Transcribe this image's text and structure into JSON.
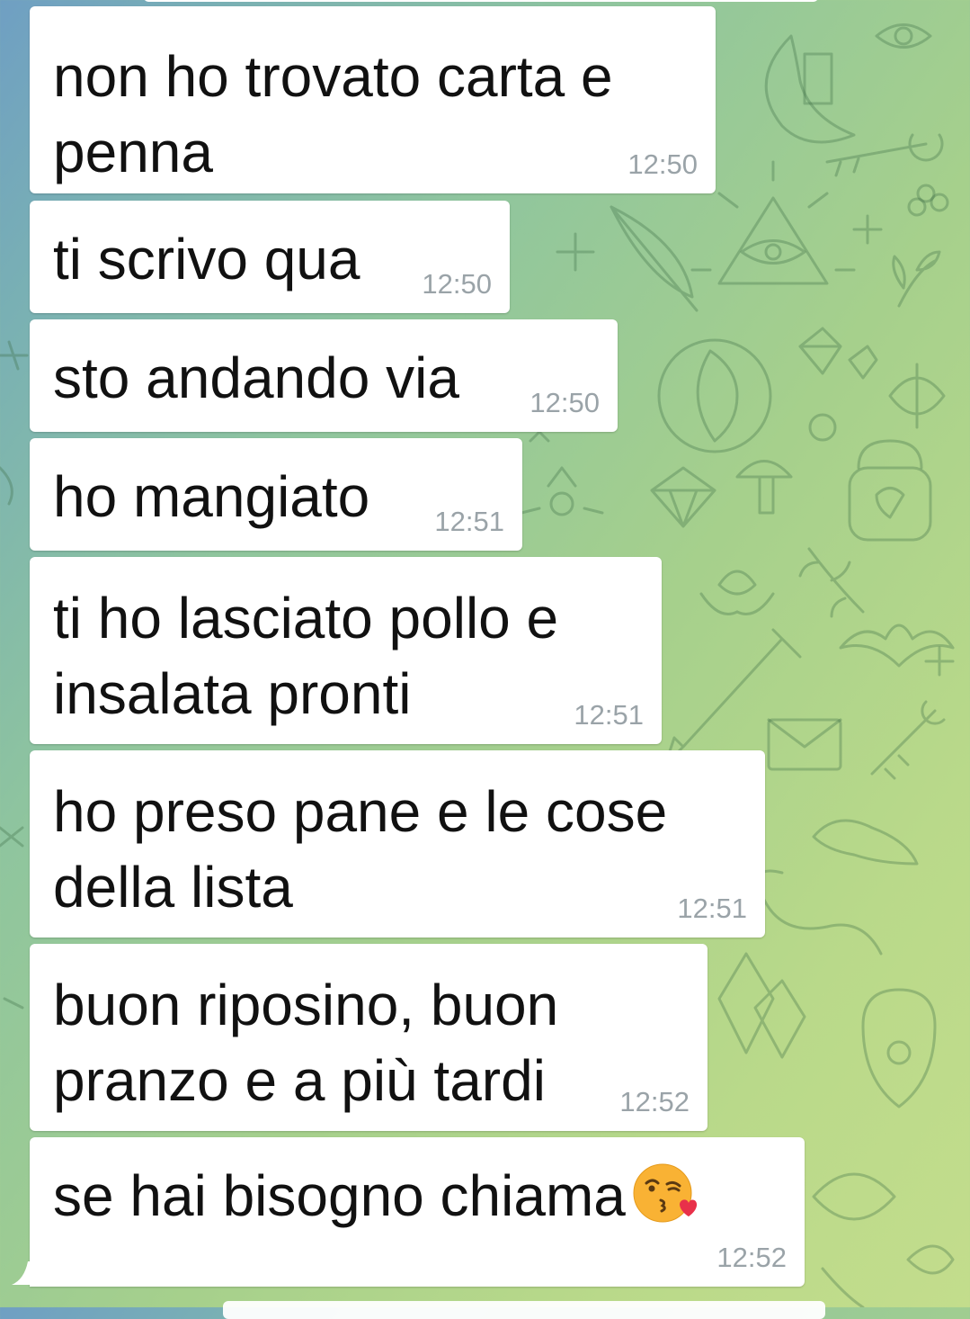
{
  "background": {
    "pattern": "telegram-doodle-wallpaper",
    "colors": [
      "#6f9fc3",
      "#8fc59e",
      "#c3dd8c"
    ]
  },
  "messages": [
    {
      "text": "non ho trovato carta e\npenna",
      "time": "12:50"
    },
    {
      "text": "ti scrivo qua",
      "time": "12:50"
    },
    {
      "text": "sto andando via",
      "time": "12:50"
    },
    {
      "text": "ho mangiato",
      "time": "12:51"
    },
    {
      "text": "ti ho lasciato pollo e\ninsalata pronti",
      "time": "12:51"
    },
    {
      "text": "ho preso pane e le cose\ndella lista",
      "time": "12:51"
    },
    {
      "text": "buon riposino, buon\npranzo e a più tardi",
      "time": "12:52"
    },
    {
      "text": "se hai bisogno chiama",
      "time": "12:52",
      "emoji": "kissing-heart-emoji"
    }
  ]
}
